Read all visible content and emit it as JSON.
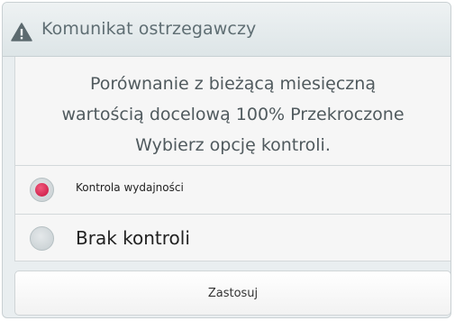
{
  "dialog": {
    "title": "Komunikat ostrzegawczy",
    "title_icon": "warning-triangle-icon",
    "message_lines": [
      "Porównanie z bieżącą miesięczną",
      "wartością docelową 100% Przekroczone",
      "Wybierz opcję kontroli."
    ],
    "options": [
      {
        "label": "Kontrola wydajności",
        "selected": true
      },
      {
        "label": "Brak kontroli",
        "selected": false
      }
    ],
    "apply_label": "Zastosuj"
  },
  "colors": {
    "accent_radio": "#d61a47",
    "title_text": "#5f6e73",
    "background": "#e9eef0"
  }
}
